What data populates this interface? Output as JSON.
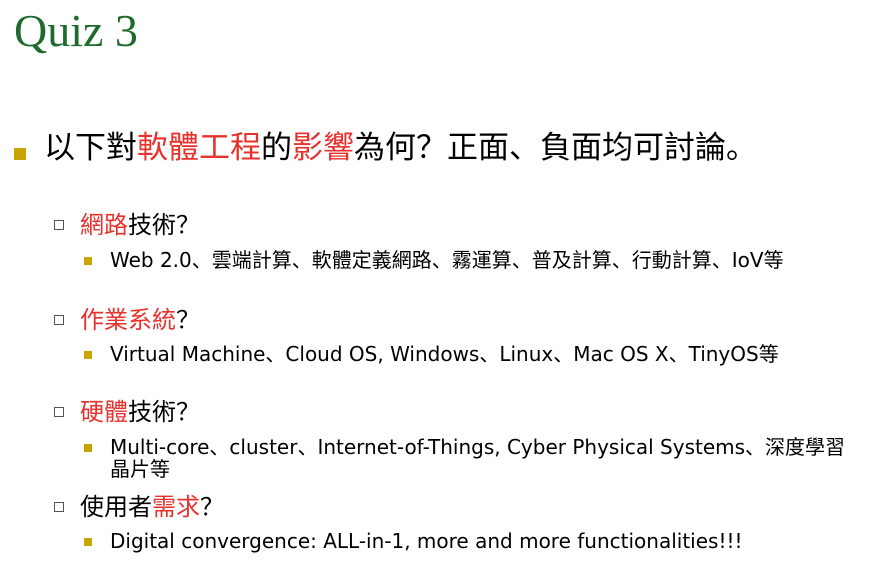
{
  "title": "Quiz 3",
  "main": {
    "prefix": "以下對",
    "hl1": "軟體工程",
    "mid": "的",
    "hl2": "影響",
    "suffix": "為何？正面、負面均可討論。"
  },
  "sections": [
    {
      "hl": "網路",
      "rest": "技術？",
      "detail": "Web 2.0、雲端計算、軟體定義網路、霧運算、普及計算、行動計算、IoV等"
    },
    {
      "hl": "作業系統",
      "rest": "？",
      "detail": "Virtual Machine、Cloud OS, Windows、Linux、Mac OS X、TinyOS等"
    },
    {
      "hl": "硬體",
      "rest": "技術？",
      "detail": "Multi-core、cluster、Internet-of-Things, Cyber Physical Systems、深度學習晶片等"
    },
    {
      "pre": "使用者",
      "hl": "需求",
      "rest": "？",
      "detail": "Digital convergence: ALL-in-1, more and more functionalities!!!"
    }
  ],
  "colors": {
    "title": "#1f6b2e",
    "highlight": "#e8312c",
    "bullet": "#c8a400"
  }
}
